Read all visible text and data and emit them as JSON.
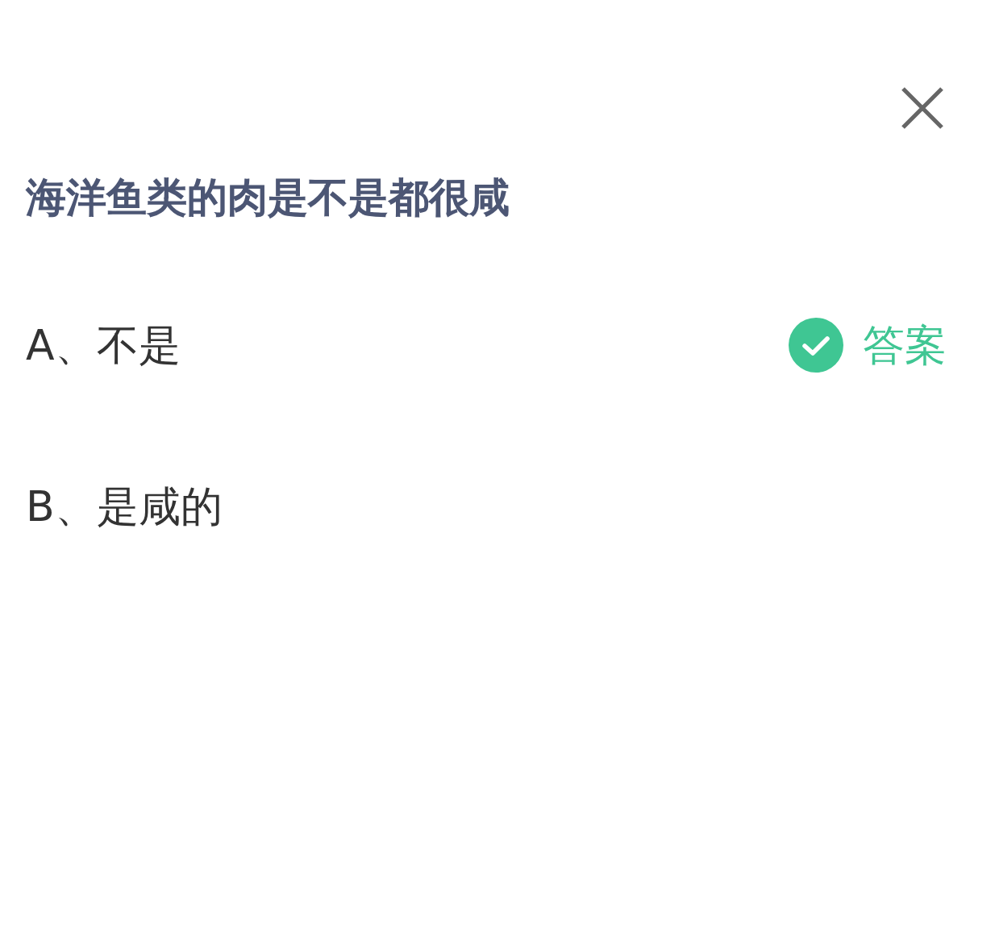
{
  "question": "海洋鱼类的肉是不是都很咸",
  "options": [
    {
      "label": "A、不是",
      "correct": true
    },
    {
      "label": "B、是咸的",
      "correct": false
    }
  ],
  "answer_tag": "答案"
}
